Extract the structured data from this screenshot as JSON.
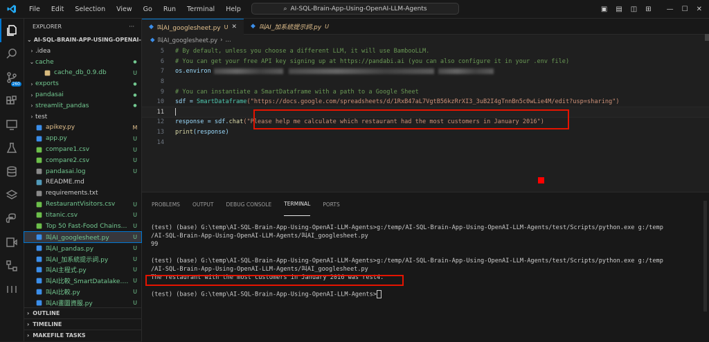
{
  "titlebar": {
    "menu": [
      "File",
      "Edit",
      "Selection",
      "View",
      "Go",
      "Run",
      "Terminal",
      "Help"
    ],
    "search": "AI-SQL-Brain-App-Using-OpenAI-LLM-Agents"
  },
  "activity": {
    "badge": "260"
  },
  "sidebar": {
    "header": "EXPLORER",
    "project": "AI-SQL-BRAIN-APP-USING-OPENAI-LL...",
    "items": [
      {
        "name": ".idea",
        "folder": true,
        "open": false,
        "indent": 0,
        "status": "",
        "color": "#cccccc",
        "dot": false
      },
      {
        "name": "cache",
        "folder": true,
        "open": true,
        "indent": 0,
        "status": "",
        "color": "#73c991",
        "dot": true
      },
      {
        "name": "cache_db_0.9.db",
        "folder": false,
        "open": false,
        "indent": 1,
        "status": "U",
        "color": "#73c991",
        "dot": false
      },
      {
        "name": "exports",
        "folder": true,
        "open": false,
        "indent": 0,
        "status": "",
        "color": "#73c991",
        "dot": true
      },
      {
        "name": "pandasai",
        "folder": true,
        "open": false,
        "indent": 0,
        "status": "",
        "color": "#73c991",
        "dot": true
      },
      {
        "name": "streamlit_pandas",
        "folder": true,
        "open": false,
        "indent": 0,
        "status": "",
        "color": "#73c991",
        "dot": true
      },
      {
        "name": "test",
        "folder": true,
        "open": false,
        "indent": 0,
        "status": "",
        "color": "#cccccc",
        "dot": false
      },
      {
        "name": "apikey.py",
        "folder": false,
        "open": false,
        "indent": 0,
        "status": "M",
        "color": "#e2c08d",
        "dot": false
      },
      {
        "name": "app.py",
        "folder": false,
        "open": false,
        "indent": 0,
        "status": "U",
        "color": "#73c991",
        "dot": false
      },
      {
        "name": "compare1.csv",
        "folder": false,
        "open": false,
        "indent": 0,
        "status": "U",
        "color": "#73c991",
        "dot": false
      },
      {
        "name": "compare2.csv",
        "folder": false,
        "open": false,
        "indent": 0,
        "status": "U",
        "color": "#73c991",
        "dot": false
      },
      {
        "name": "pandasai.log",
        "folder": false,
        "open": false,
        "indent": 0,
        "status": "U",
        "color": "#73c991",
        "dot": false
      },
      {
        "name": "README.md",
        "folder": false,
        "open": false,
        "indent": 0,
        "status": "",
        "color": "#cccccc",
        "dot": false
      },
      {
        "name": "requirements.txt",
        "folder": false,
        "open": false,
        "indent": 0,
        "status": "",
        "color": "#cccccc",
        "dot": false
      },
      {
        "name": "RestaurantVisitors.csv",
        "folder": false,
        "open": false,
        "indent": 0,
        "status": "U",
        "color": "#73c991",
        "dot": false
      },
      {
        "name": "titanic.csv",
        "folder": false,
        "open": false,
        "indent": 0,
        "status": "U",
        "color": "#73c991",
        "dot": false
      },
      {
        "name": "Top 50 Fast-Food Chains in ...",
        "folder": false,
        "open": false,
        "indent": 0,
        "status": "U",
        "color": "#73c991",
        "dot": false
      },
      {
        "name": "叫AI_googlesheet.py",
        "folder": false,
        "open": false,
        "indent": 0,
        "status": "U",
        "color": "#73c991",
        "dot": false,
        "selected": true
      },
      {
        "name": "叫AI_pandas.py",
        "folder": false,
        "open": false,
        "indent": 0,
        "status": "U",
        "color": "#73c991",
        "dot": false
      },
      {
        "name": "叫AI_加系統提示詞.py",
        "folder": false,
        "open": false,
        "indent": 0,
        "status": "U",
        "color": "#73c991",
        "dot": false
      },
      {
        "name": "叫AI主程式.py",
        "folder": false,
        "open": false,
        "indent": 0,
        "status": "U",
        "color": "#73c991",
        "dot": false
      },
      {
        "name": "叫AI比較_SmartDatalake.py",
        "folder": false,
        "open": false,
        "indent": 0,
        "status": "U",
        "color": "#73c991",
        "dot": false
      },
      {
        "name": "叫AI比較.py",
        "folder": false,
        "open": false,
        "indent": 0,
        "status": "U",
        "color": "#73c991",
        "dot": false
      },
      {
        "name": "叫AI畫圖資服.py",
        "folder": false,
        "open": false,
        "indent": 0,
        "status": "U",
        "color": "#73c991",
        "dot": false
      }
    ],
    "sections": [
      "OUTLINE",
      "TIMELINE",
      "MAKEFILE TASKS"
    ]
  },
  "editor": {
    "tabs": [
      {
        "label": "叫AI_googlesheet.py",
        "status": "U"
      },
      {
        "label": "叫AI_加系統提示詞.py",
        "status": "U"
      }
    ],
    "breadcrumb": "叫AI_googlesheet.py",
    "lines": [
      {
        "n": "5",
        "text": "# By default, unless you choose a different LLM, it will use BambooLLM."
      },
      {
        "n": "6",
        "text": "# You can get your free API key signing up at https://pandabi.ai (you can also configure it in your .env file)"
      },
      {
        "n": "7",
        "text": "os.environ"
      },
      {
        "n": "8",
        "text": ""
      },
      {
        "n": "9",
        "text": "# You can instantiate a SmartDataframe with a path to a Google Sheet"
      },
      {
        "n": "10",
        "text_a": "sdf = ",
        "text_b": "SmartDataframe",
        "text_c": "(\"https://docs.google.com/spreadsheets/d/1RxB47aL7VgtB56kzRrXI3_3uB2I4gTnnBn5c0wLie4M/edit?usp=sharing\")"
      },
      {
        "n": "11",
        "text": ""
      },
      {
        "n": "12",
        "text_a": "response = sdf.",
        "text_b": "chat",
        "text_c": "(\"Please help me calculate which restaurant had the most customers in January 2016\")"
      },
      {
        "n": "13",
        "text_a": "print",
        "text_b": "(response)"
      },
      {
        "n": "14",
        "text": ""
      }
    ]
  },
  "panel": {
    "tabs": [
      "PROBLEMS",
      "OUTPUT",
      "DEBUG CONSOLE",
      "TERMINAL",
      "PORTS"
    ],
    "active_tab": "TERMINAL",
    "terminal": [
      "(test) (base) G:\\temp\\AI-SQL-Brain-App-Using-OpenAI-LLM-Agents>g:/temp/AI-SQL-Brain-App-Using-OpenAI-LLM-Agents/test/Scripts/python.exe g:/temp",
      "/AI-SQL-Brain-App-Using-OpenAI-LLM-Agents/叫AI_googlesheet.py",
      "99",
      "",
      "(test) (base) G:\\temp\\AI-SQL-Brain-App-Using-OpenAI-LLM-Agents>g:/temp/AI-SQL-Brain-App-Using-OpenAI-LLM-Agents/test/Scripts/python.exe g:/temp",
      "/AI-SQL-Brain-App-Using-OpenAI-LLM-Agents/叫AI_googlesheet.py",
      "The restaurant with the most customers in January 2016 was rest4.",
      "",
      "(test) (base) G:\\temp\\AI-SQL-Brain-App-Using-OpenAI-LLM-Agents>"
    ]
  },
  "colors": {
    "accent": "#0078d4",
    "highlight": "#e51400",
    "untracked": "#73c991",
    "modified": "#e2c08d"
  }
}
